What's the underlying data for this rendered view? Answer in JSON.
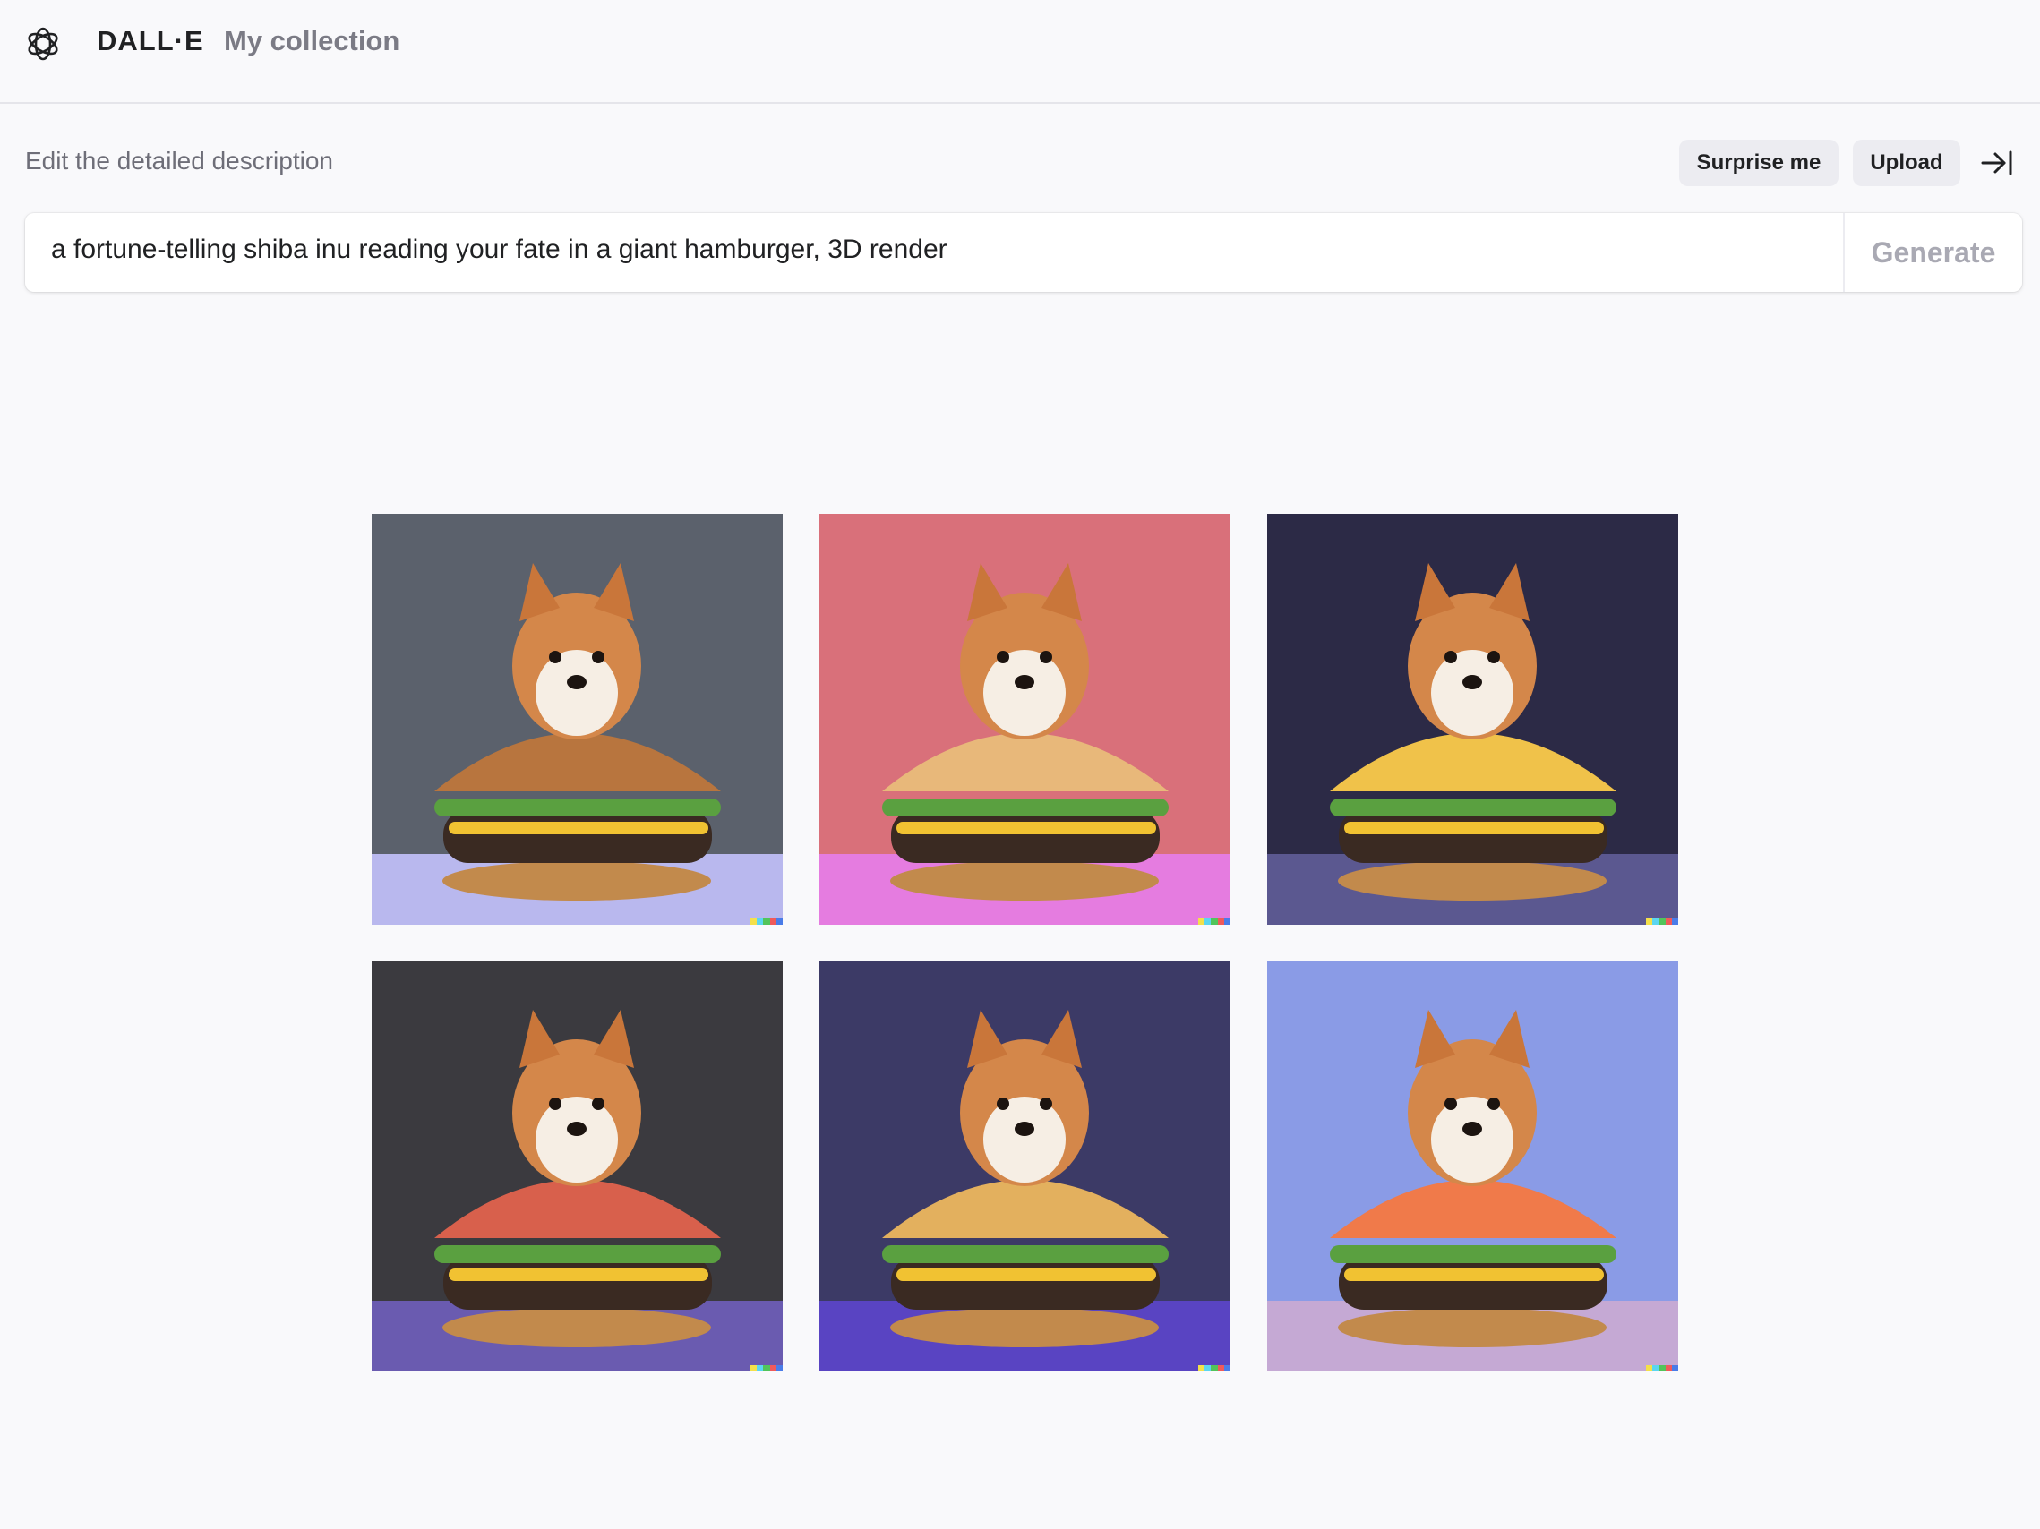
{
  "header": {
    "brand": "DALL·E",
    "nav_link": "My collection",
    "logo_icon": "openai-logo-icon"
  },
  "prompt": {
    "label": "Edit the detailed description",
    "surprise_label": "Surprise me",
    "upload_label": "Upload",
    "collapse_icon": "collapse-right-icon",
    "value": "a fortune-telling shiba inu reading your fate in a giant hamburger, 3D render",
    "generate_label": "Generate"
  },
  "results": {
    "images": [
      {
        "background": "#5b616c",
        "floor": "#b9b8ee",
        "bun": "#b8753e"
      },
      {
        "background": "#d9707a",
        "floor": "#e57ce0",
        "bun": "#e8b87a"
      },
      {
        "background": "#2c2a46",
        "floor": "#5b5890",
        "bun": "#f0c24a"
      },
      {
        "background": "#3b3a3f",
        "floor": "#6a5bb0",
        "bun": "#d8604c"
      },
      {
        "background": "#3c3a66",
        "floor": "#5944c2",
        "bun": "#e3b05e"
      },
      {
        "background": "#8a9be6",
        "floor": "#c5a9d4",
        "bun": "#f07a4a"
      }
    ],
    "signature_colors": [
      "#f4e04a",
      "#5bd6f0",
      "#52c45a",
      "#f05a5a",
      "#4a7ce8"
    ]
  }
}
